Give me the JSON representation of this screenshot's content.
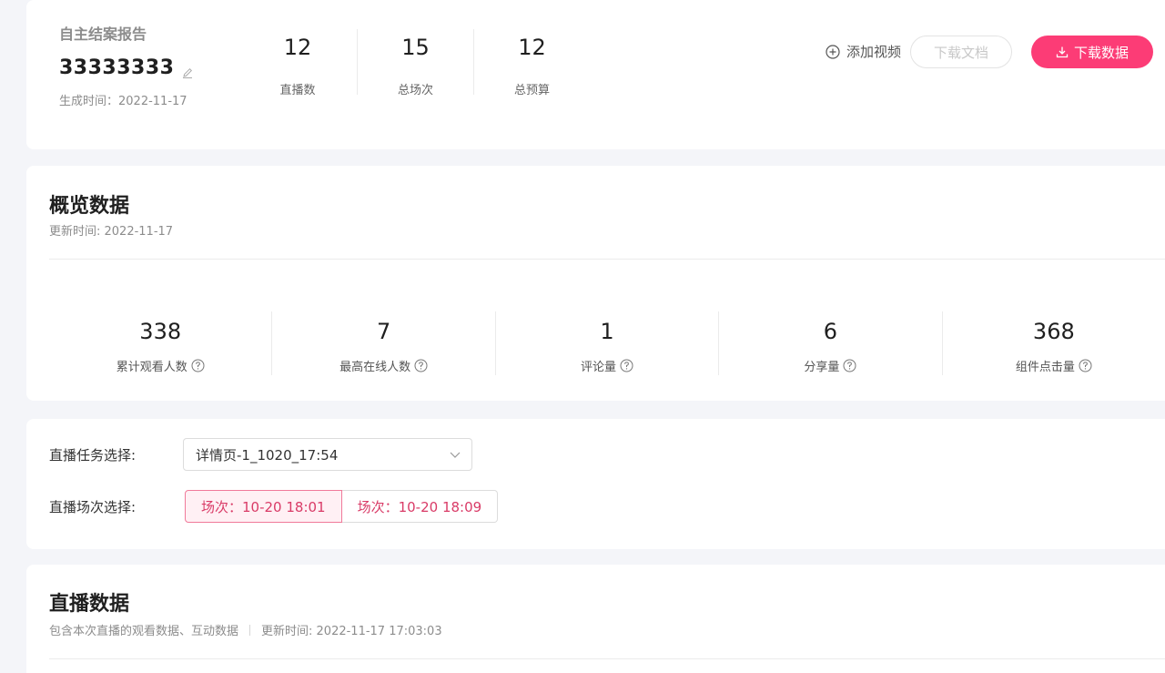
{
  "report": {
    "label": "自主结案报告",
    "name": "33333333",
    "generated_time": "生成时间：2022-11-17",
    "stats": [
      {
        "value": "12",
        "label": "直播数"
      },
      {
        "value": "15",
        "label": "总场次"
      },
      {
        "value": "12",
        "label": "总预算"
      }
    ],
    "add_video_label": "添加视频",
    "download_doc_label": "下载文档",
    "download_data_label": "下载数据"
  },
  "overview": {
    "title": "概览数据",
    "updated": "更新时间: 2022-11-17",
    "stats": [
      {
        "value": "338",
        "label": "累计观看人数"
      },
      {
        "value": "7",
        "label": "最高在线人数"
      },
      {
        "value": "1",
        "label": "评论量"
      },
      {
        "value": "6",
        "label": "分享量"
      },
      {
        "value": "368",
        "label": "组件点击量"
      }
    ]
  },
  "selector": {
    "task_label": "直播任务选择:",
    "task_value": "详情页-1_1020_17:54",
    "session_label": "直播场次选择:",
    "sessions": [
      {
        "label": "场次：10-20 18:01",
        "active": true
      },
      {
        "label": "场次：10-20 18:09",
        "active": false
      }
    ]
  },
  "live": {
    "title": "直播数据",
    "desc": "包含本次直播的观看数据、互动数据",
    "updated": "更新时间: 2022-11-17 17:03:03"
  },
  "colors": {
    "accent": "#fc3c76",
    "background": "#f4f5f9"
  }
}
